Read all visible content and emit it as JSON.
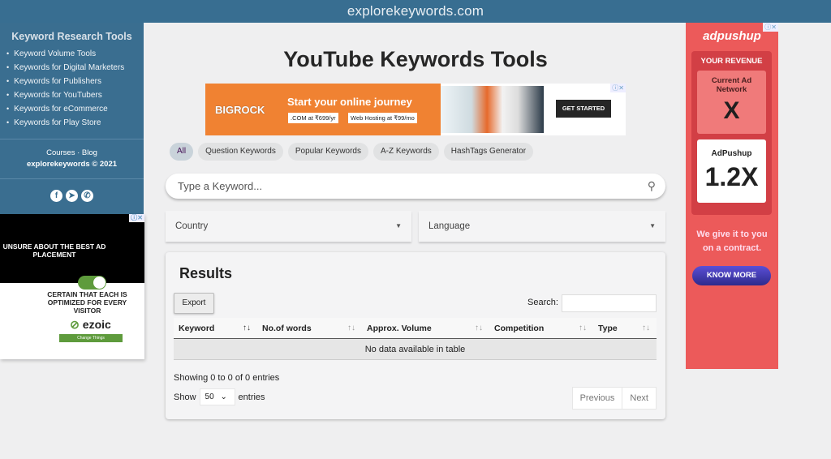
{
  "topbar": {
    "site": "explorekeywords.com"
  },
  "sidebar": {
    "heading": "Keyword Research Tools",
    "items": [
      {
        "label": "Keyword Volume Tools"
      },
      {
        "label": "Keywords for Digital Marketers"
      },
      {
        "label": "Keywords for Publishers"
      },
      {
        "label": "Keywords for YouTubers"
      },
      {
        "label": "Keywords for eCommerce"
      },
      {
        "label": "Keywords for Play Store"
      }
    ],
    "footer_links": "Courses · Blog",
    "copyright": "explorekeywords © 2021",
    "social": [
      {
        "icon": "facebook-icon",
        "glyph": "f"
      },
      {
        "icon": "telegram-icon",
        "glyph": "➤"
      },
      {
        "icon": "whatsapp-icon",
        "glyph": "✆"
      }
    ]
  },
  "ezoic_ad": {
    "top_text": "UNSURE ABOUT THE BEST AD PLACEMENT",
    "mid_text": "CERTAIN THAT EACH IS OPTIMIZED FOR EVERY VISITOR",
    "brand": "ezoic",
    "button": "Change Things"
  },
  "page": {
    "title": "YouTube Keywords Tools"
  },
  "bigrock_ad": {
    "brand": "BIGROCK",
    "headline": "Start your online journey",
    "offer1": ".COM at ₹699/yr",
    "offer2": "Web Hosting at ₹99/mo",
    "button": "GET STARTED"
  },
  "chips": [
    {
      "label": "All",
      "active": true
    },
    {
      "label": "Question Keywords"
    },
    {
      "label": "Popular Keywords"
    },
    {
      "label": "A-Z Keywords"
    },
    {
      "label": "HashTags Generator"
    }
  ],
  "search": {
    "placeholder": "Type a Keyword...",
    "value": ""
  },
  "filters": {
    "country": "Country",
    "language": "Language"
  },
  "results": {
    "title": "Results",
    "export": "Export",
    "search_label": "Search:",
    "columns": [
      "Keyword",
      "No.of words",
      "Approx. Volume",
      "Competition",
      "Type"
    ],
    "empty": "No data available in table",
    "info": "Showing 0 to 0 of 0 entries",
    "show_label": "Show",
    "page_length": "50",
    "entries_label": "entries",
    "previous": "Previous",
    "next": "Next"
  },
  "adpushup_ad": {
    "brand": "adpushup",
    "your_revenue": "YOUR REVENUE",
    "current_label": "Current Ad Network",
    "current_value": "X",
    "adpushup_label": "AdPushup",
    "adpushup_value": "1.2X",
    "tagline": "We give it to you on a contract.",
    "button": "KNOW MORE"
  }
}
